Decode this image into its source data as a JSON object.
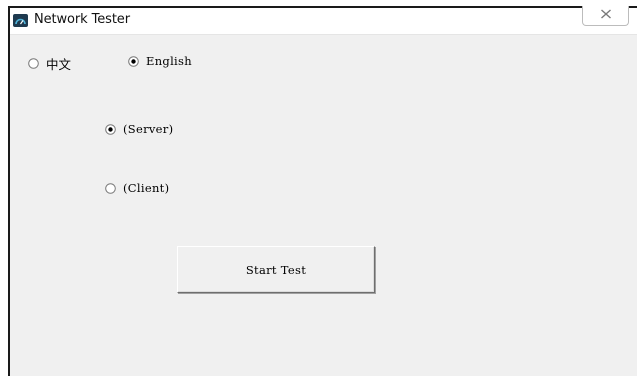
{
  "window": {
    "title": "Network Tester",
    "close_glyph": "X"
  },
  "language": {
    "options": [
      {
        "label": "中文",
        "selected": false
      },
      {
        "label": "English",
        "selected": true
      }
    ]
  },
  "mode": {
    "options": [
      {
        "label": "(Server)",
        "selected": true
      },
      {
        "label": "(Client)",
        "selected": false
      }
    ]
  },
  "actions": {
    "start_label": "Start Test"
  },
  "icons": {
    "app": "network-speedometer-icon",
    "close": "close-icon",
    "radio_checked": "radio-checked-icon",
    "radio_unchecked": "radio-unchecked-icon"
  },
  "colors": {
    "window_bg": "#f0f0f0",
    "titlebar_bg": "#ffffff",
    "app_icon_bg": "#1e3a4f",
    "app_icon_accent": "#4fb3d9"
  }
}
